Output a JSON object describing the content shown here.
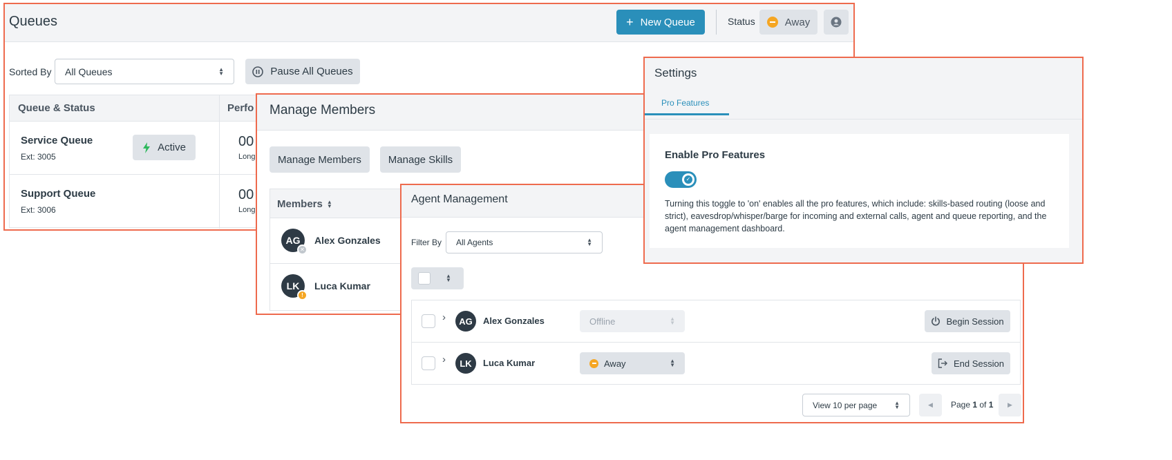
{
  "queues": {
    "title": "Queues",
    "new_queue_label": "New Queue",
    "status_label": "Status",
    "status_value": "Away",
    "sorted_by_label": "Sorted By",
    "sort_select": "All Queues",
    "pause_all_label": "Pause All Queues",
    "col_queue_status": "Queue & Status",
    "col_performance": "Perfo",
    "rows": [
      {
        "name": "Service Queue",
        "ext": "Ext: 3005",
        "status": "Active",
        "metric": "00",
        "metric_label": "Long"
      },
      {
        "name": "Support Queue",
        "ext": "Ext: 3006",
        "metric": "00",
        "metric_label": "Long"
      }
    ]
  },
  "members": {
    "title": "Manage Members",
    "tab_manage_members": "Manage Members",
    "tab_manage_skills": "Manage Skills",
    "col_members": "Members",
    "rows": [
      {
        "initials": "AG",
        "name": "Alex Gonzales"
      },
      {
        "initials": "LK",
        "name": "Luca Kumar"
      }
    ]
  },
  "agents": {
    "title": "Agent Management",
    "filter_label": "Filter By",
    "filter_value": "All Agents",
    "rows": [
      {
        "initials": "AG",
        "name": "Alex Gonzales",
        "status": "Offline",
        "action": "Begin Session"
      },
      {
        "initials": "LK",
        "name": "Luca Kumar",
        "status": "Away",
        "action": "End Session"
      }
    ],
    "per_page": "View 10 per page",
    "page_prefix": "Page ",
    "page_current": "1",
    "page_of": " of ",
    "page_total": "1"
  },
  "settings": {
    "title": "Settings",
    "tab": "Pro Features",
    "card_title": "Enable Pro Features",
    "toggle_on": true,
    "description": "Turning this toggle to 'on' enables all the pro features, which include: skills-based routing (loose and strict), eavesdrop/whisper/barge for incoming and external calls, agent and queue reporting, and the agent management dashboard."
  },
  "colors": {
    "accent": "#2a8fba",
    "panel_border": "#ee6a4d",
    "away": "#f5a623",
    "active_bolt": "#2eb85c"
  }
}
